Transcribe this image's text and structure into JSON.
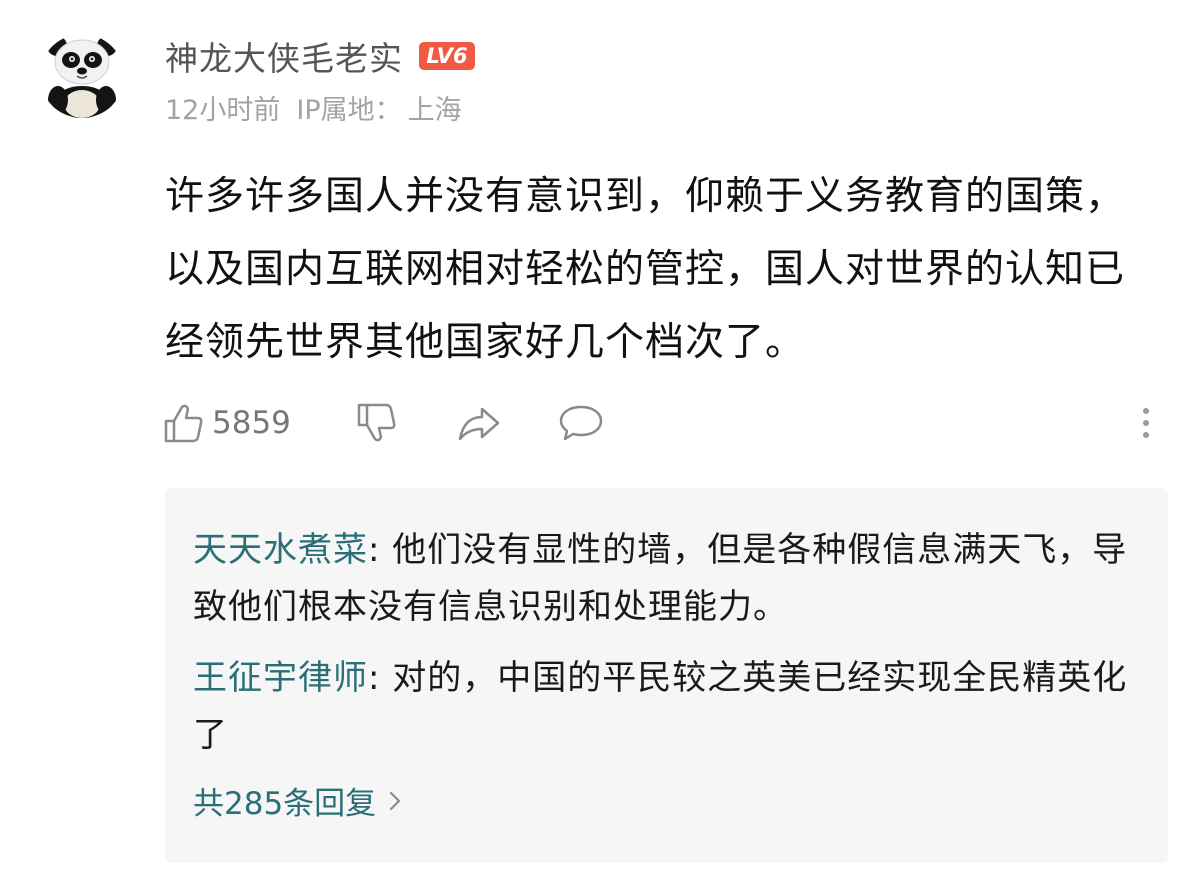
{
  "post": {
    "username": "神龙大侠毛老实",
    "level": "LV6",
    "time_ago": "12小时前",
    "ip_label": "IP属地：",
    "ip_location": "上海",
    "content": "许多许多国人并没有意识到，仰赖于义务教育的国策，以及国内互联网相对轻松的管控，国人对世界的认知已经领先世界其他国家好几个档次了。",
    "like_count": "5859"
  },
  "icons": {
    "avatar": "panda-avatar",
    "like": "thumbs-up-icon",
    "dislike": "thumbs-down-icon",
    "share": "share-arrow-icon",
    "comment": "comment-bubble-icon",
    "more": "more-vertical-icon"
  },
  "replies": [
    {
      "user": "天天水煮菜",
      "sep": ": ",
      "text": "他们没有显性的墙，但是各种假信息满天飞，导致他们根本没有信息识别和处理能力。"
    },
    {
      "user": "王征宇律师",
      "sep": ": ",
      "text": "对的，中国的平民较之英美已经实现全民精英化了"
    }
  ],
  "total_replies": "共285条回复",
  "colors": {
    "level_badge": "#f05a44",
    "reply_user": "#2a6e78",
    "meta_text": "#a3a3a3",
    "reply_bg": "#f6f6f6"
  }
}
